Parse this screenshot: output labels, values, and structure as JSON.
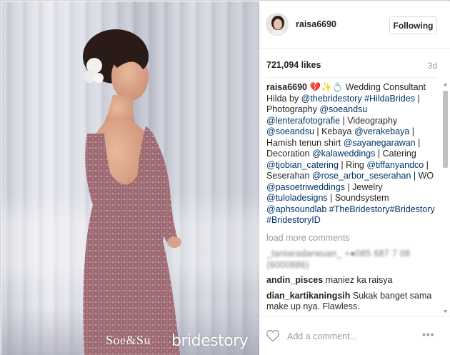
{
  "post": {
    "username": "raisa6690",
    "follow_label": "Following",
    "likes": "721,094 likes",
    "age": "3d"
  },
  "caption": {
    "username": "raisa6690",
    "emoji": "💔✨💍",
    "parts": [
      {
        "text": " Wedding Consultant Hilda by ",
        "type": "t"
      },
      {
        "text": "@thebridestory",
        "type": "a"
      },
      {
        "text": " ",
        "type": "t"
      },
      {
        "text": "#HildaBrides",
        "type": "a"
      },
      {
        "text": " | Photography ",
        "type": "t"
      },
      {
        "text": "@soeandsu",
        "type": "a"
      },
      {
        "text": " ",
        "type": "t"
      },
      {
        "text": "@lenterafotografie",
        "type": "a"
      },
      {
        "text": " | Videography ",
        "type": "t"
      },
      {
        "text": "@soeandsu",
        "type": "a"
      },
      {
        "text": " | Kebaya ",
        "type": "t"
      },
      {
        "text": "@verakebaya",
        "type": "a"
      },
      {
        "text": " | Hamish tenun shirt ",
        "type": "t"
      },
      {
        "text": "@sayanegarawan",
        "type": "a"
      },
      {
        "text": " | Decoration ",
        "type": "t"
      },
      {
        "text": "@kalaweddings",
        "type": "a"
      },
      {
        "text": " | Catering ",
        "type": "t"
      },
      {
        "text": "@tjobian_catering",
        "type": "a"
      },
      {
        "text": " | Ring ",
        "type": "t"
      },
      {
        "text": "@tiffanyandco",
        "type": "a"
      },
      {
        "text": " | Seserahan ",
        "type": "t"
      },
      {
        "text": "@rose_arbor_seserahan",
        "type": "a"
      },
      {
        "text": " | WO ",
        "type": "t"
      },
      {
        "text": "@pasoetriweddings",
        "type": "a"
      },
      {
        "text": " | Jewelry ",
        "type": "t"
      },
      {
        "text": "@tuloladesigns",
        "type": "a"
      },
      {
        "text": " | Soundsystem ",
        "type": "t"
      },
      {
        "text": "@aphsoundlab",
        "type": "a"
      },
      {
        "text": " ",
        "type": "t"
      },
      {
        "text": "#TheBridestory",
        "type": "a"
      },
      {
        "text": "#Bridestory",
        "type": "a"
      },
      {
        "text": " ",
        "type": "t"
      },
      {
        "text": "#BridestoryID",
        "type": "a"
      }
    ]
  },
  "load_more": "load more comments",
  "blurred_comment": "_tantaradarwuan_ +●085 687 7 08 (6000886)",
  "comments": [
    {
      "username": "andin_pisces",
      "text": "maniez ka raisya"
    },
    {
      "username": "dian_kartikaningsih",
      "text": "Sukak banget sama make up nya. Flawless."
    }
  ],
  "add_comment_placeholder": "Add a comment...",
  "more_label": "•••",
  "watermarks": {
    "left": "Soe&Su",
    "right": "bridestory"
  }
}
